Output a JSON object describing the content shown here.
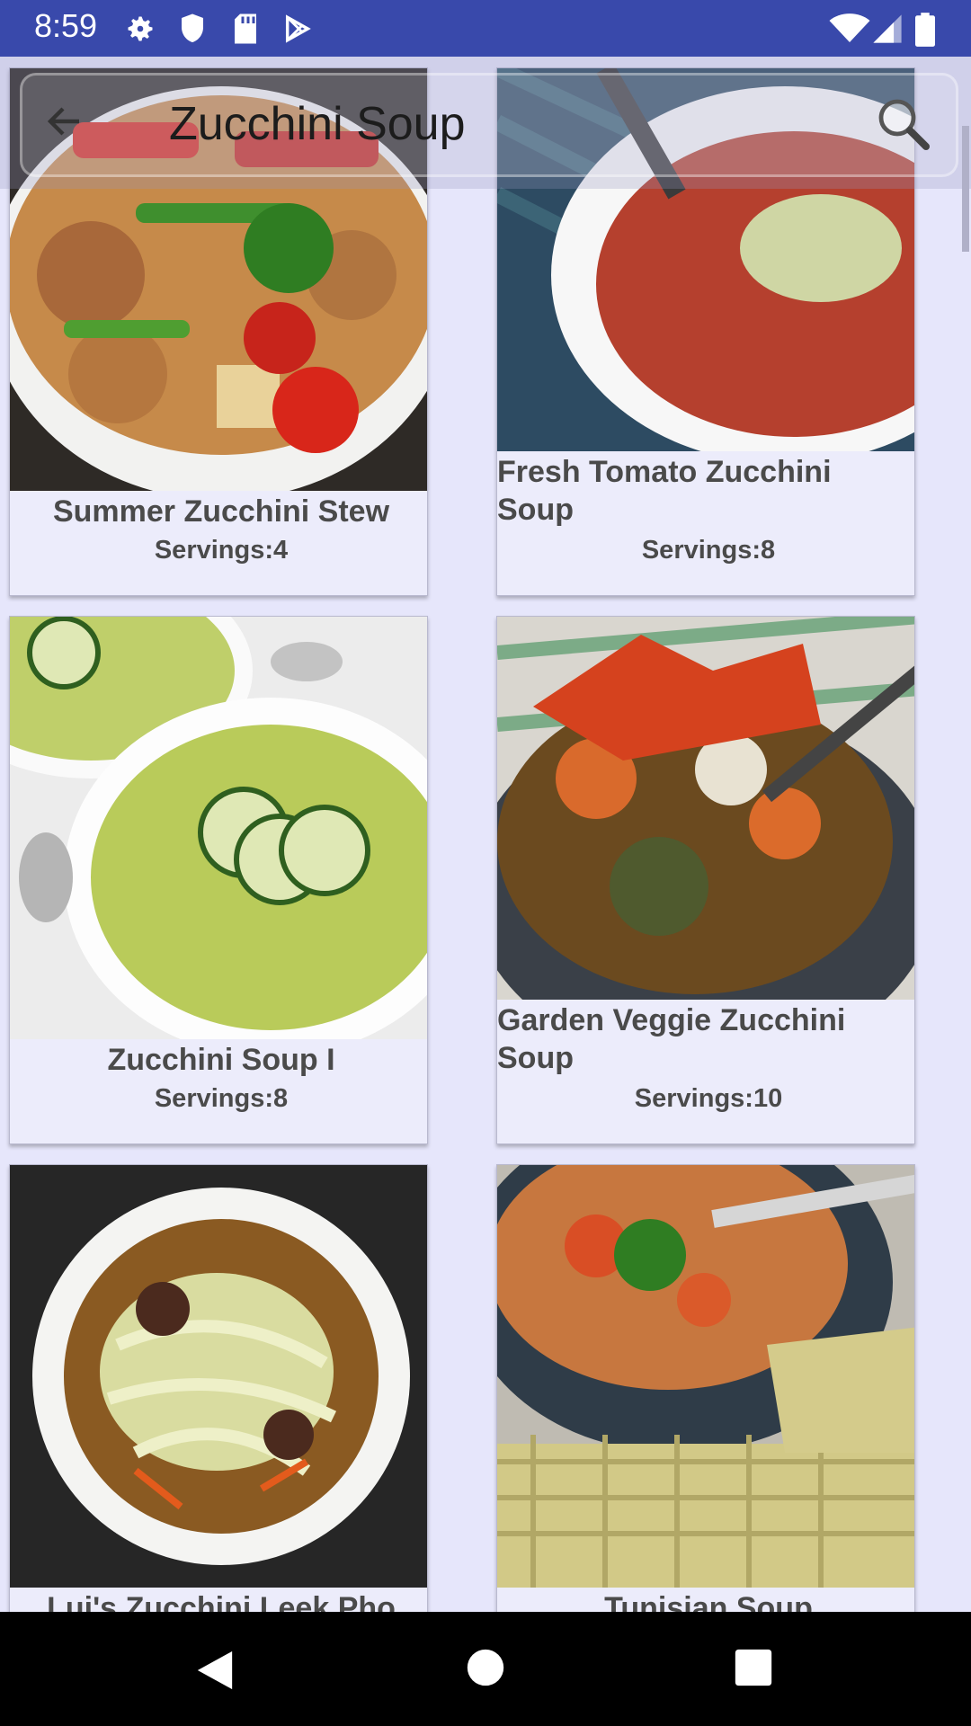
{
  "status_bar": {
    "time": "8:59",
    "left_icons": [
      "gear-icon",
      "shield-icon",
      "sd-card-icon",
      "play-store-icon"
    ],
    "right_icons": [
      "wifi-icon",
      "signal-icon",
      "battery-icon"
    ]
  },
  "app_bar": {
    "title": "Zucchini Soup",
    "back_icon": "arrow-back-icon",
    "search_icon": "search-icon"
  },
  "recipes": [
    {
      "title": "Summer Zucchini Stew",
      "servings": "Servings:4"
    },
    {
      "title": "Fresh Tomato Zucchini Soup",
      "title_line1": "Fresh Tomato Zucchini",
      "title_line2": "Soup",
      "servings": "Servings:8"
    },
    {
      "title": "Zucchini Soup I",
      "servings": "Servings:8"
    },
    {
      "title": "Garden Veggie Zucchini Soup",
      "title_line1": "Garden Veggie Zucchini",
      "title_line2": "Soup",
      "servings": "Servings:10"
    },
    {
      "title": "Lui's Zucchini Leek Pho"
    },
    {
      "title": "Tunisian Soup"
    }
  ],
  "nav_bar": {
    "buttons": [
      "back-triangle-icon",
      "home-circle-icon",
      "recents-square-icon"
    ]
  },
  "colors": {
    "status_bar": "#3949ab",
    "background": "#e6e6fb",
    "card": "#ececfb",
    "text": "#4a4a4a"
  }
}
